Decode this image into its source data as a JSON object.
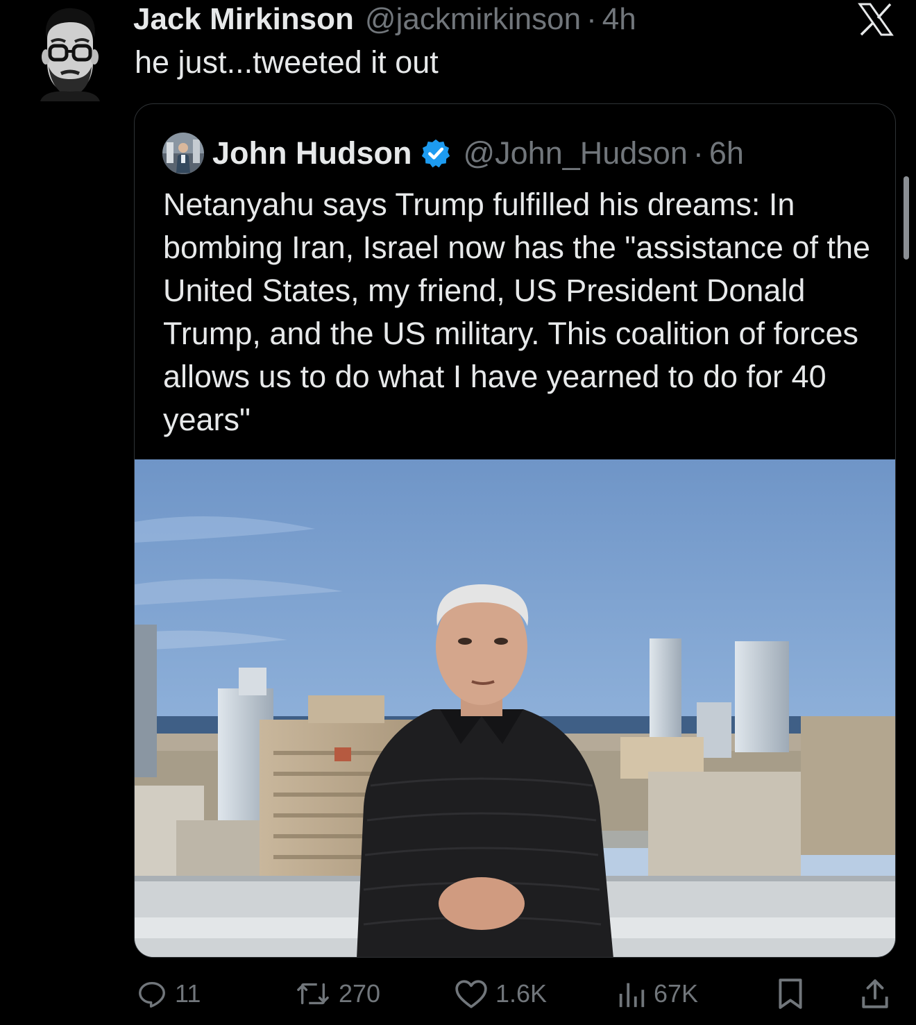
{
  "tweet": {
    "author_name": "Jack Mirkinson",
    "author_handle": "@jackmirkinson",
    "separator": "·",
    "time": "4h",
    "text": "he just...tweeted it out",
    "avatar_icon": "user-avatar-photo"
  },
  "quoted_tweet": {
    "author_name": "John Hudson",
    "verified": true,
    "author_handle": "@John_Hudson",
    "separator": "·",
    "time": "6h",
    "text": "Netanyahu says Trump fulfilled his dreams: In bombing Iran, Israel now has the \"assistance of the United States, my friend, US President Donald Trump, and the US military. This coalition of forces allows us to do what I have yearned to do for 40 years\"",
    "media_icon": "photo-man-on-rooftop-city-skyline"
  },
  "actions": {
    "replies": "11",
    "reposts": "270",
    "likes": "1.6K",
    "views": "67K"
  },
  "colors": {
    "background": "#000000",
    "text_primary": "#e7e9ea",
    "text_secondary": "#71767b",
    "border": "#2f3336",
    "verified_badge": "#1d9bf0"
  }
}
